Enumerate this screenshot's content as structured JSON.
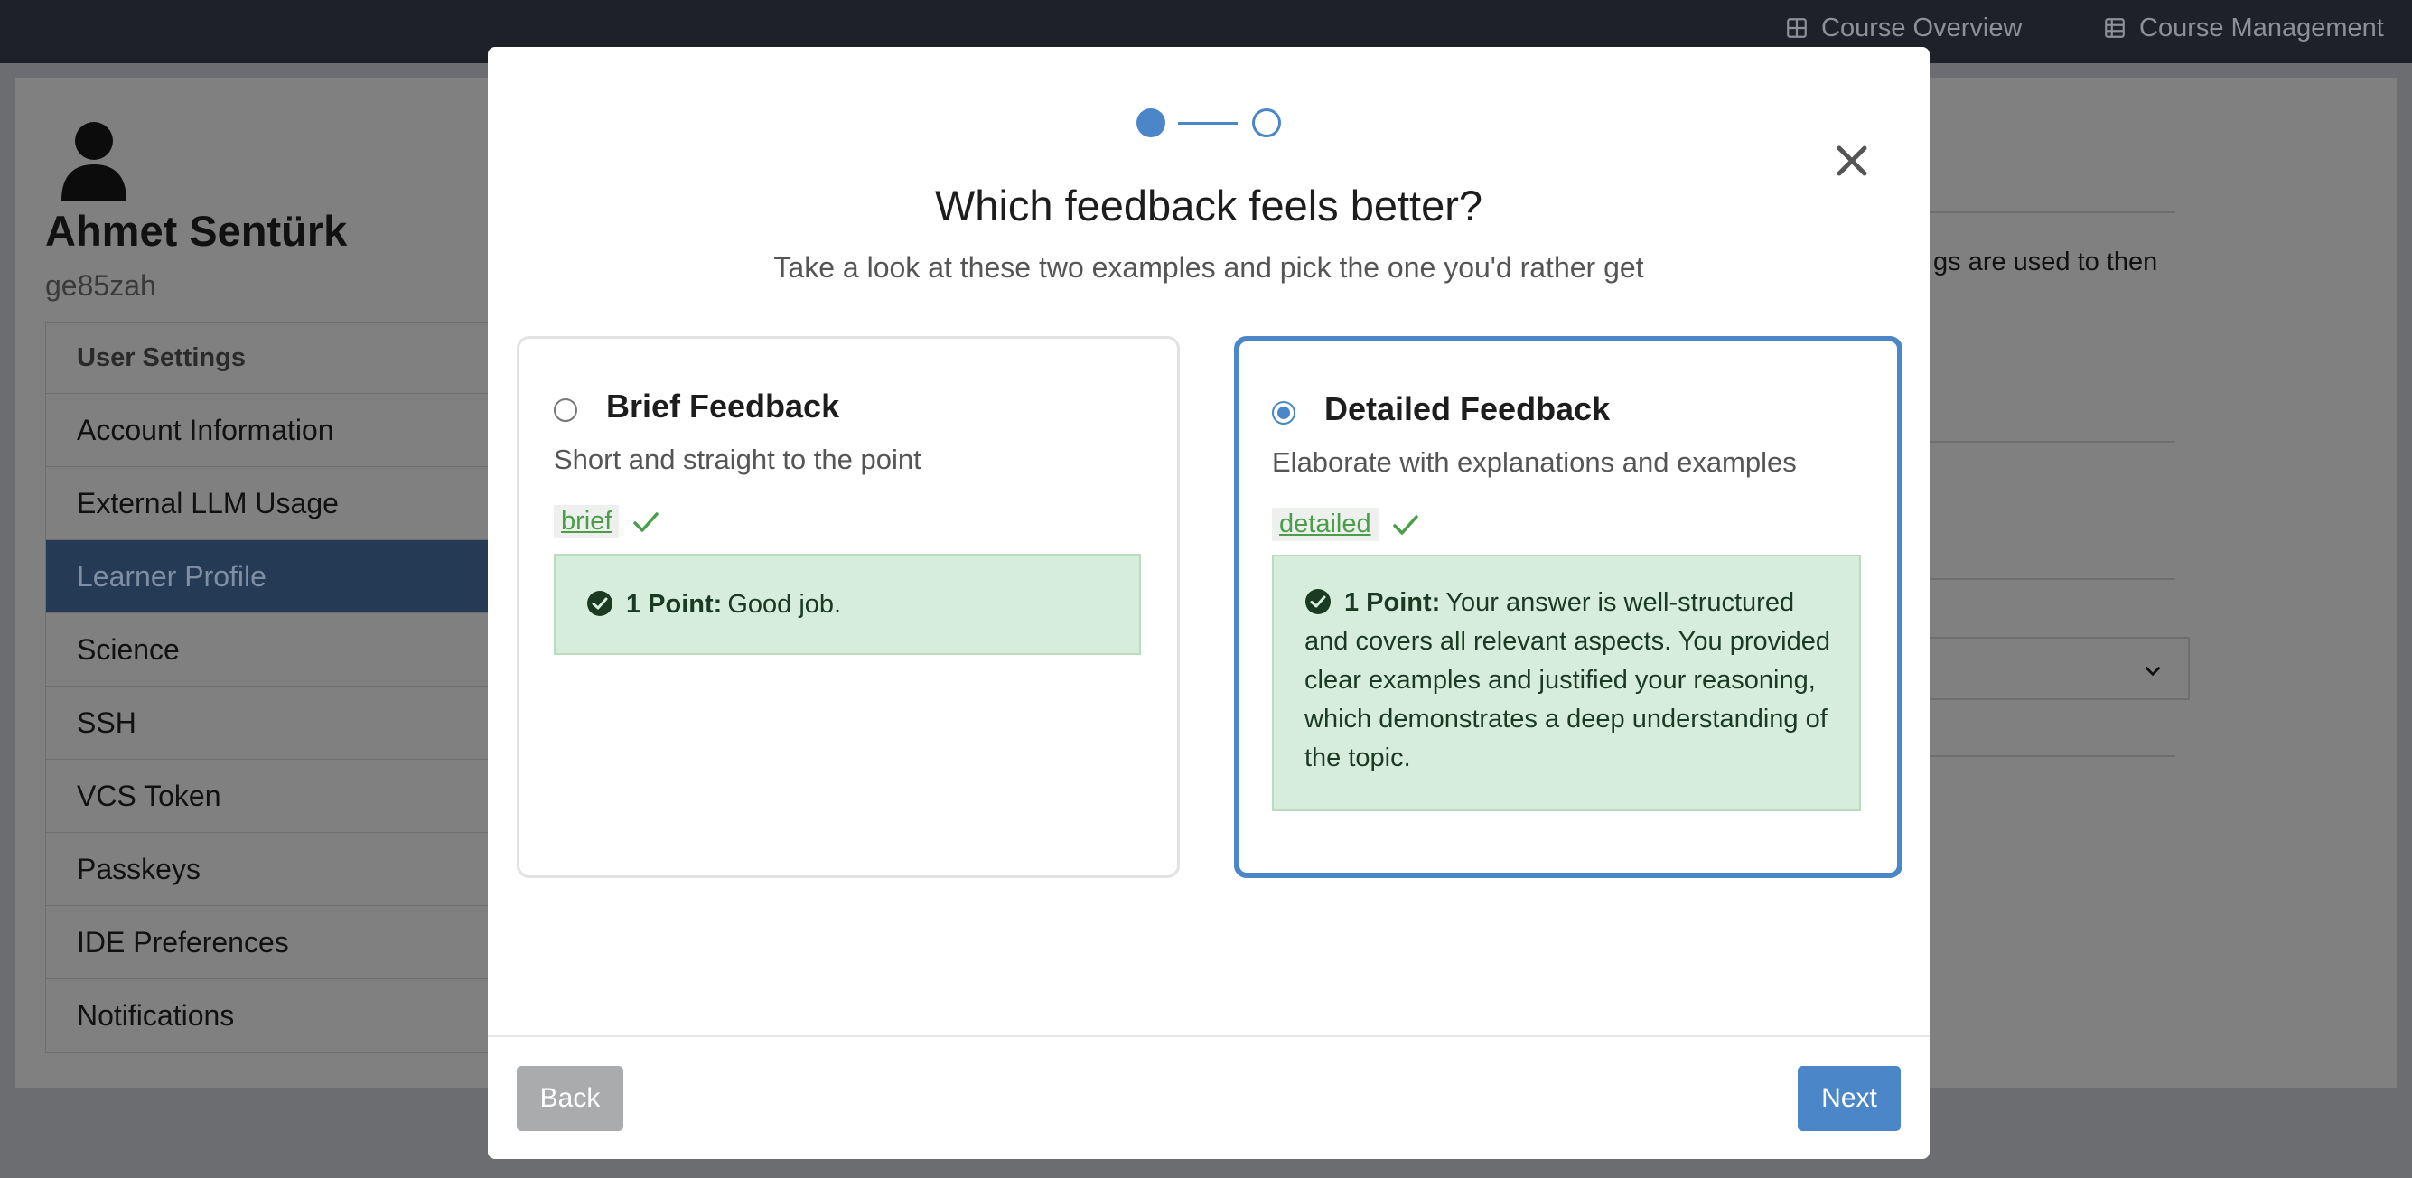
{
  "navbar": {
    "links": [
      {
        "label": "Course Overview",
        "icon": "grid-icon"
      },
      {
        "label": "Course Management",
        "icon": "table-icon"
      }
    ]
  },
  "profile": {
    "name": "Ahmet Sentürk",
    "login": "ge85zah"
  },
  "sidebar": {
    "header": "User Settings",
    "items": [
      {
        "label": "Account Information"
      },
      {
        "label": "External LLM Usage"
      },
      {
        "label": "Learner Profile",
        "active": true
      },
      {
        "label": "Science"
      },
      {
        "label": "SSH"
      },
      {
        "label": "VCS Token"
      },
      {
        "label": "Passkeys"
      },
      {
        "label": "IDE Preferences"
      },
      {
        "label": "Notifications"
      }
    ]
  },
  "background": {
    "partial_text": "gs are used to then"
  },
  "modal": {
    "step_current": 1,
    "step_total": 2,
    "title": "Which feedback feels better?",
    "subtitle": "Take a look at these two examples and pick the one you'd rather get",
    "options": [
      {
        "title": "Brief Feedback",
        "description": "Short and straight to the point",
        "tag": "brief",
        "selected": false,
        "feedback_points": "1 Point:",
        "feedback_text": "Good job."
      },
      {
        "title": "Detailed Feedback",
        "description": "Elaborate with explanations and examples",
        "tag": "detailed",
        "selected": true,
        "feedback_points": "1 Point:",
        "feedback_text": "Your answer is well-structured and covers all relevant aspects. You provided clear examples and justified your reasoning, which demonstrates a deep understanding of the topic."
      }
    ],
    "back_label": "Back",
    "next_label": "Next"
  },
  "colors": {
    "accent": "#4a86c8",
    "success_bg": "#d7eddb",
    "success_text": "#4a9e4a",
    "navbar_bg": "#1e2228"
  }
}
